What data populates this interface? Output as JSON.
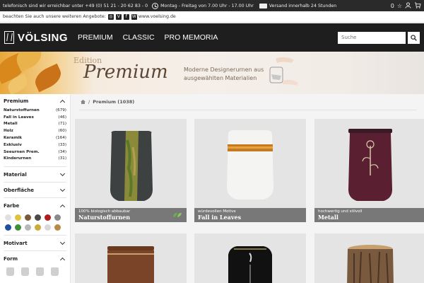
{
  "topbar": {
    "phone_text": "telefonisch sind wir erreichbar unter",
    "phone": "+49 (0) 51 21 - 20 62 83 - 0",
    "hours": "Montag - Freitag von 7.00 Uhr - 17.00 Uhr",
    "shipping": "Versand innerhalb 24 Stunden",
    "cart_count": "0"
  },
  "socialbar": {
    "text": "beachten Sie auch unsere weiteren Angebote:",
    "site": "www.voelsing.de"
  },
  "nav": {
    "brand": "VÖLSING",
    "links": [
      "PREMIUM",
      "CLASSIC",
      "PRO MEMORIA"
    ],
    "search_placeholder": "Suche"
  },
  "banner": {
    "edition": "Edition",
    "title": "Premium",
    "subtitle_line1": "Moderne Designerurnen aus",
    "subtitle_line2": "ausgewählten Materialien"
  },
  "sidebar": {
    "title": "Premium",
    "categories": [
      {
        "label": "Naturstoffurnen",
        "count": "(679)"
      },
      {
        "label": "Fall in Leaves",
        "count": "(46)"
      },
      {
        "label": "Metall",
        "count": "(71)"
      },
      {
        "label": "Holz",
        "count": "(60)"
      },
      {
        "label": "Keramik",
        "count": "(164)"
      },
      {
        "label": "Exklusiv",
        "count": "(33)"
      },
      {
        "label": "Seeurnen Prem.",
        "count": "(34)"
      },
      {
        "label": "Kinderurnen",
        "count": "(31)"
      }
    ],
    "filters": [
      "Material",
      "Oberfläche",
      "Farbe",
      "Motivart",
      "Form"
    ],
    "swatch_colors": [
      "#e0e0e0",
      "#e2c13a",
      "#7a5a3a",
      "#4a4a4a",
      "#b21c1c",
      "#8a8a8a",
      "#1f4fa0",
      "#3f8f3a",
      "#b8b8b8",
      "#c9ad3a",
      "#d8d8d8",
      "#b88a4a"
    ]
  },
  "breadcrumb": {
    "current": "Premium (1038)"
  },
  "products": [
    {
      "subtitle": "100% biologisch abbaubar",
      "name": "Naturstoffurnen"
    },
    {
      "subtitle": "würdevollen Motive",
      "name": "Fall in Leaves"
    },
    {
      "subtitle": "hochwertig und stilvoll",
      "name": "Metall"
    }
  ],
  "colors": {
    "nav_bg": "#1e1e1e",
    "accent_leaf": "#d9891c"
  }
}
